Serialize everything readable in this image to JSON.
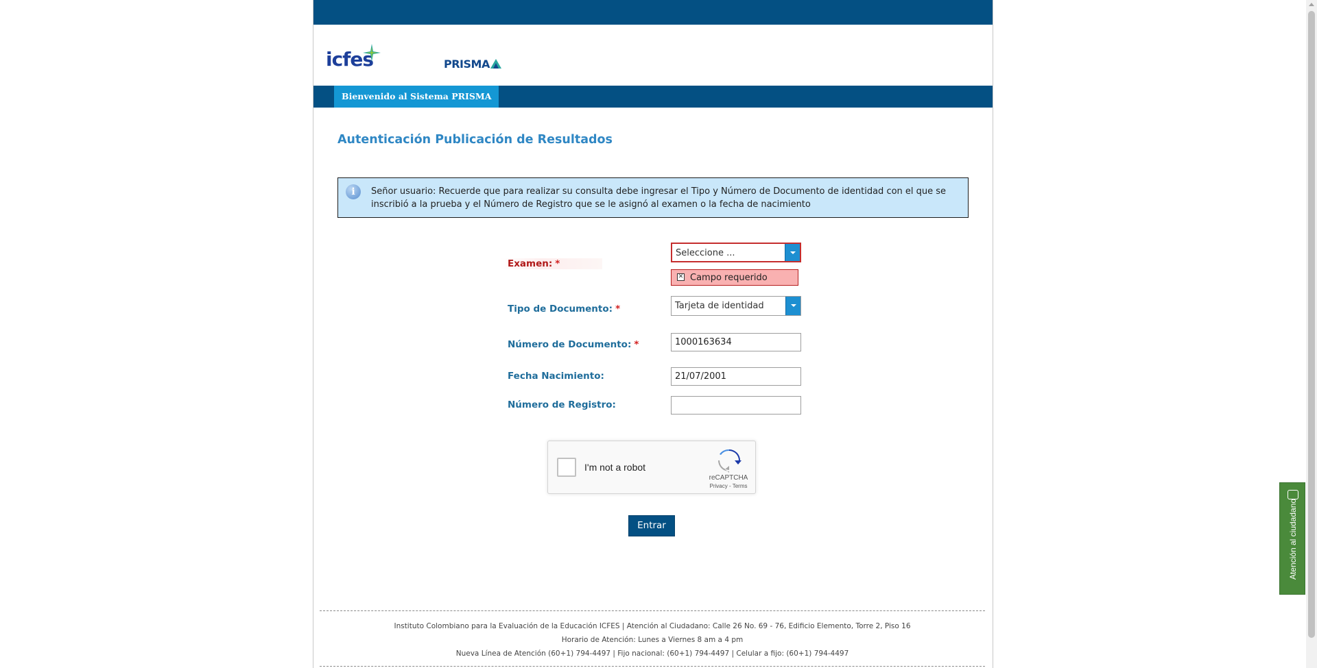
{
  "header": {
    "logo_icfes": "icfes",
    "logo_prisma": "PRISMA",
    "nav_tab": "Bienvenido al Sistema PRISMA"
  },
  "main": {
    "title": "Autenticación Publicación de Resultados",
    "info": "Señor usuario: Recuerde que para realizar su consulta debe ingresar el Tipo y Número de Documento de identidad con el que se inscribió a la prueba y el Número de Registro que se le asignó al examen o la fecha de nacimiento"
  },
  "form": {
    "examen_label": "Examen:",
    "examen_value": "Seleccione ...",
    "required_mark": "*",
    "error_msg": "Campo requerido",
    "tipo_label": "Tipo de Documento:",
    "tipo_value": "Tarjeta de identidad",
    "numero_label": "Número de Documento:",
    "numero_value": "1000163634",
    "fecha_label": "Fecha Nacimiento:",
    "fecha_value": "21/07/2001",
    "registro_label": "Número de Registro:",
    "registro_value": ""
  },
  "captcha": {
    "label": "I'm not a robot",
    "brand": "reCAPTCHA",
    "links": "Privacy - Terms"
  },
  "submit_label": "Entrar",
  "footer": {
    "line1": "Instituto Colombiano para la Evaluación de la Educación ICFES  |  Atención al Ciudadano: Calle 26 No. 69 - 76, Edificio Elemento, Torre 2, Piso 16",
    "line2": "Horario de Atención: Lunes a Viernes 8 am a 4 pm",
    "line3": "Nueva Línea de Atención (60+1) 794-4497  |  Fijo nacional: (60+1) 794-4497  |  Celular a fijo: (60+1) 794-4497"
  },
  "side_tab": "Atención al ciudadano",
  "colors": {
    "primary": "#045083",
    "accent": "#1497d4",
    "title": "#2f87c4",
    "info_bg": "#c9e7fa",
    "error": "#c52d2d",
    "side_tab": "#4a8a3b"
  }
}
